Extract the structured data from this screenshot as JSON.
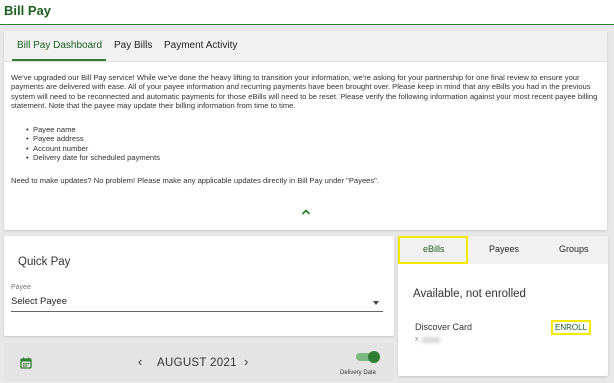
{
  "header": {
    "title": "Bill Pay"
  },
  "tabs": [
    "Bill Pay Dashboard",
    "Pay Bills",
    "Payment Activity"
  ],
  "notice": {
    "paragraph": "We've upgraded our Bill Pay service! While we've done the heavy lifting to transition your information, we're asking for your partnership for one final review to ensure your payments are delivered with ease. All of your payee information and recurring payments have been brought over. Please keep in mind that any eBills you had in the previous system will need to be reconnected and automatic payments for those eBills will need to be reset. Please verify the following information against your most recent payee billing statement. Note that the payee may update their billing information from time to time.",
    "bullets": [
      "Payee name",
      "Payee address",
      "Account number",
      "Delivery date for scheduled payments"
    ],
    "footer": "Need to make updates? No problem! Please make any applicable updates directly in Bill Pay under \"Payees\"."
  },
  "quick_pay": {
    "title": "Quick Pay",
    "payee_label": "Payee",
    "payee_value": "Select Payee"
  },
  "calendar": {
    "month": "AUGUST 2021",
    "prev_glyph": "‹",
    "next_glyph": "›",
    "toggle_label": "Delivery Date",
    "toggle_on": true
  },
  "ebills": {
    "tabs": [
      "eBills",
      "Payees",
      "Groups"
    ],
    "section_title": "Available, not enrolled",
    "account_name": "Discover Card",
    "account_mask": "x",
    "enroll_label": "ENROLL"
  },
  "colors": {
    "accent": "#2e7d32",
    "highlight": "#f5e900"
  },
  "icons": [
    "chevron-up-icon",
    "dropdown-arrow-icon",
    "calendar-icon",
    "chevron-left-icon",
    "chevron-right-icon"
  ]
}
